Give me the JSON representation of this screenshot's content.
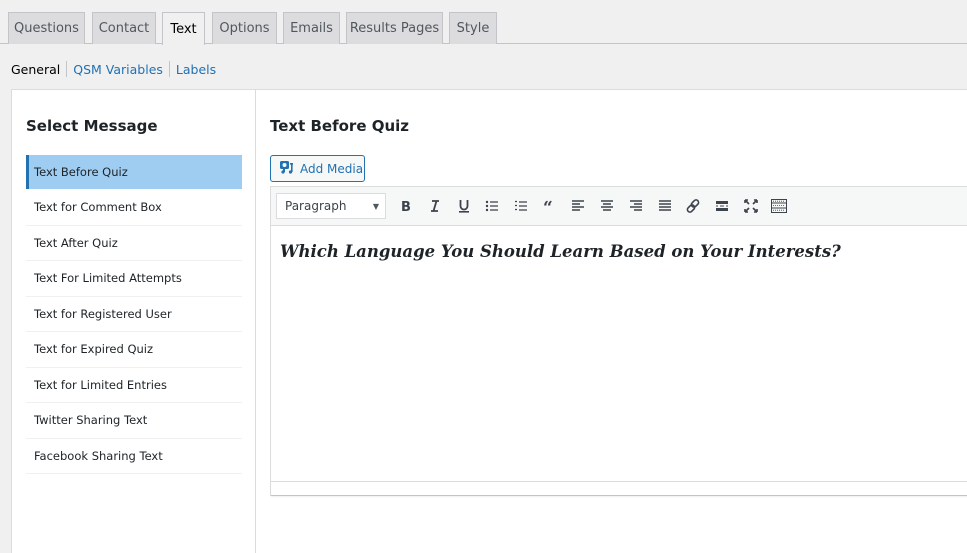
{
  "tabs": [
    {
      "label": "Questions",
      "active": false
    },
    {
      "label": "Contact",
      "active": false
    },
    {
      "label": "Text",
      "active": true
    },
    {
      "label": "Options",
      "active": false
    },
    {
      "label": "Emails",
      "active": false
    },
    {
      "label": "Results Pages",
      "active": false
    },
    {
      "label": "Style",
      "active": false
    }
  ],
  "subnav": {
    "items": [
      "General",
      "QSM Variables",
      "Labels"
    ],
    "current": "General"
  },
  "left": {
    "title": "Select Message",
    "messages": [
      "Text Before Quiz",
      "Text for Comment Box",
      "Text After Quiz",
      "Text For Limited Attempts",
      "Text for Registered User",
      "Text for Expired Quiz",
      "Text for Limited Entries",
      "Twitter Sharing Text",
      "Facebook Sharing Text"
    ],
    "active_index": 0
  },
  "right": {
    "title": "Text Before Quiz",
    "add_media_label": "Add Media",
    "editor": {
      "format_value": "Paragraph",
      "toolbar_icons": [
        "bold-icon",
        "italic-icon",
        "underline-icon",
        "bullet-list-icon",
        "numbered-list-icon",
        "blockquote-icon",
        "align-left-icon",
        "align-center-icon",
        "align-right-icon",
        "align-justify-icon",
        "link-icon",
        "read-more-icon",
        "fullscreen-icon",
        "toolbar-toggle-icon"
      ],
      "content": "Which Language You Should Learn Based on Your Interests?"
    }
  },
  "colors": {
    "accent": "#2271b1",
    "active_item_bg": "#9fcdf2",
    "page_bg": "#f0f0f1"
  }
}
